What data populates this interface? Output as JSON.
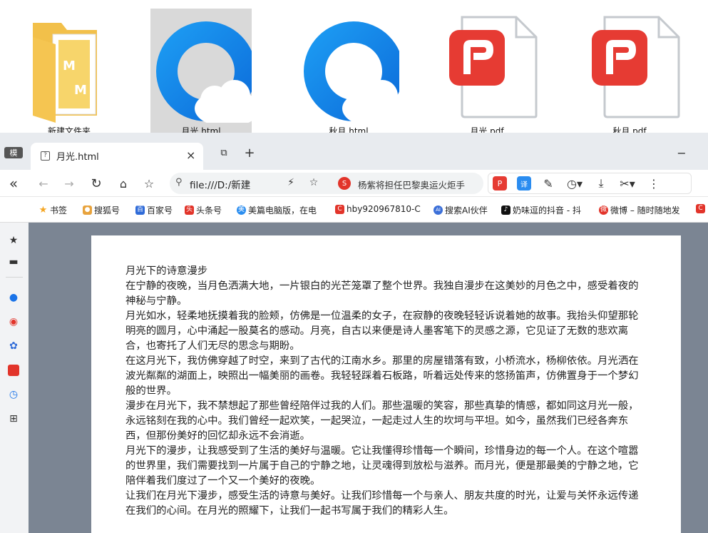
{
  "desktop": {
    "icons": [
      {
        "label": "新建文件夹",
        "icon": "folder-icon"
      },
      {
        "label": "月光.html",
        "icon": "html-file-icon"
      },
      {
        "label": "秋月.html",
        "icon": "html-file-icon"
      },
      {
        "label": "月光.pdf",
        "icon": "pdf-file-icon"
      },
      {
        "label": "秋月.pdf",
        "icon": "pdf-file-icon"
      }
    ]
  },
  "browser": {
    "mode_label": "模",
    "tab": {
      "title": "月光.html",
      "close": "×"
    },
    "new_tab": "+",
    "minimize": "−",
    "address": {
      "url": "file:///D:/新建",
      "news": "杨紫将担任巴黎奥运火炬手"
    },
    "bookmarks": [
      {
        "label": "书签",
        "color": "#f5a623",
        "glyph": "★"
      },
      {
        "label": "搜狐号",
        "color": "#e8a33d",
        "glyph": "●"
      },
      {
        "label": "百家号",
        "color": "#2f6bd8",
        "glyph": "百"
      },
      {
        "label": "头条号",
        "color": "#e2342a",
        "glyph": "头"
      },
      {
        "label": "美篇电脑版，在电",
        "color": "#2b8ef0",
        "glyph": "美"
      },
      {
        "label": "hby920967810-C",
        "color": "#e2342a",
        "glyph": "C"
      },
      {
        "label": "搜索AI伙伴",
        "color": "#3b6fd8",
        "glyph": "AI"
      },
      {
        "label": "奶味逗的抖音 - 抖",
        "color": "#111111",
        "glyph": "♪"
      },
      {
        "label": "微博 – 随时随地发",
        "color": "#e2342a",
        "glyph": "微"
      }
    ]
  },
  "document": {
    "paragraphs": [
      "月光下的诗意漫步",
      "在宁静的夜晚，当月色洒满大地，一片银白的光芒笼罩了整个世界。我独自漫步在这美妙的月色之中，感受着夜的神秘与宁静。",
      "月光如水，轻柔地抚摸着我的脸颊，仿佛是一位温柔的女子，在寂静的夜晚轻轻诉说着她的故事。我抬头仰望那轮明亮的圆月，心中涌起一股莫名的感动。月亮，自古以来便是诗人墨客笔下的灵感之源，它见证了无数的悲欢离合，也寄托了人们无尽的思念与期盼。",
      "在这月光下，我仿佛穿越了时空，来到了古代的江南水乡。那里的房屋错落有致，小桥流水，杨柳依依。月光洒在波光粼粼的湖面上，映照出一幅美丽的画卷。我轻轻踩着石板路，听着远处传来的悠扬笛声，仿佛置身于一个梦幻般的世界。",
      "漫步在月光下，我不禁想起了那些曾经陪伴过我的人们。那些温暖的笑容，那些真挚的情感，都如同这月光一般，永远铭刻在我的心中。我们曾经一起欢笑，一起哭泣，一起走过人生的坎坷与平坦。如今，虽然我们已经各奔东西，但那份美好的回忆却永远不会消逝。",
      "月光下的漫步，让我感受到了生活的美好与温暖。它让我懂得珍惜每一个瞬间，珍惜身边的每一个人。在这个喧嚣的世界里，我们需要找到一片属于自己的宁静之地，让灵魂得到放松与滋养。而月光，便是那最美的宁静之地，它陪伴着我们度过了一个又一个美好的夜晚。",
      "让我们在月光下漫步，感受生活的诗意与美好。让我们珍惜每一个与亲人、朋友共度的时光，让爱与关怀永远传递在我们的心间。在月光的照耀下，让我们一起书写属于我们的精彩人生。"
    ]
  }
}
